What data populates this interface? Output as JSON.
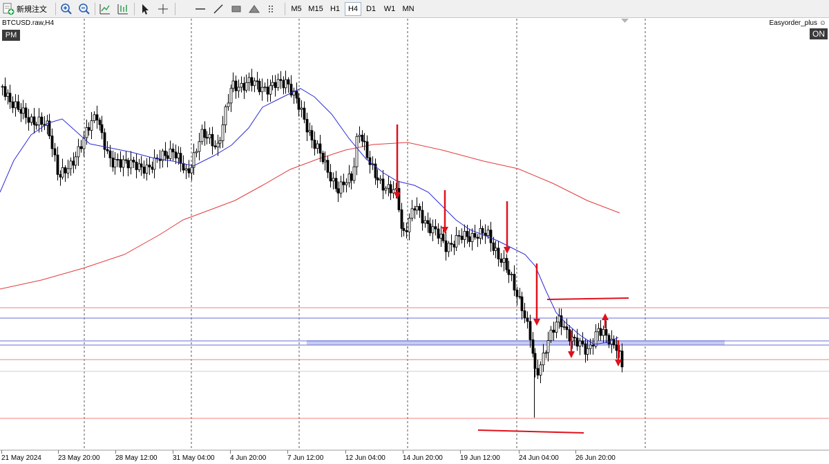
{
  "toolbar": {
    "new_order_label": "新規注文",
    "timeframes": [
      "M5",
      "M15",
      "H1",
      "H4",
      "D1",
      "W1",
      "MN"
    ],
    "active_timeframe": "H4"
  },
  "chart": {
    "symbol": "BTCUSD.raw,H4",
    "pm_badge": "PM",
    "ea_name": "Easyorder_plus",
    "ea_status": "ON",
    "x_labels": [
      "21 May 2024",
      "23 May 20:00",
      "28 May 12:00",
      "31 May 04:00",
      "4 Jun 20:00",
      "7 Jun 12:00",
      "12 Jun 04:00",
      "14 Jun 20:00",
      "19 Jun 12:00",
      "24 Jun 04:00",
      "26 Jun 20:00"
    ],
    "colors": {
      "ma_fast": "#2b2bd6",
      "ma_slow": "#e23b3b",
      "h_red": "#f08080",
      "h_blue": "#6b6bd8",
      "zone": "#c6cdef",
      "arrow": "#e0101a",
      "candle": "#000000"
    }
  }
}
